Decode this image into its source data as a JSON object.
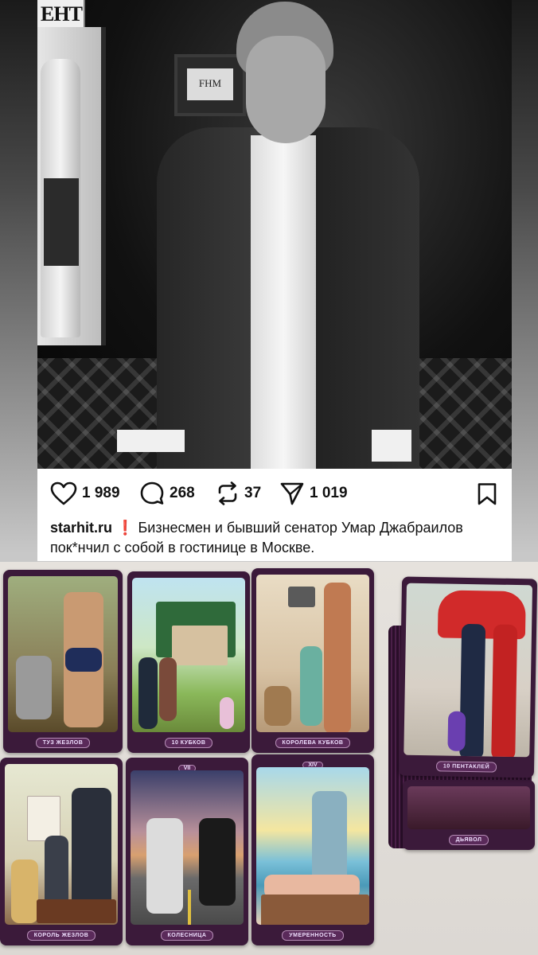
{
  "post": {
    "likes": "1 989",
    "comments": "268",
    "reposts": "37",
    "shares": "1 019",
    "caption_user": "starhit.ru",
    "caption_alert": "❗",
    "caption_text": "Бизнесмен и бывший сенатор Умар Джабраилов пок*нчил с собой в гостинице в Москве.",
    "photo_sign": "ЕНТ",
    "photo_plaque": "FHM"
  },
  "cards": {
    "c1": "ТУЗ ЖЕЗЛОВ",
    "c2": "10 КУБКОВ",
    "c3": "КОРОЛЕВА КУБКОВ",
    "c4": "10 ПЕНТАКЛЕЙ",
    "c5": "КОРОЛЬ ЖЕЗЛОВ",
    "c6": "КОЛЕСНИЦА",
    "c6_num": "VII",
    "c7": "УМЕРЕННОСТЬ",
    "c7_num": "XIV",
    "c8": "ДЬЯВОЛ"
  },
  "colors": {
    "alert": "#e0242a",
    "card_frame": "#3b1a3a",
    "card_label": "#5a2a5a"
  },
  "icons": [
    "heart-icon",
    "comment-icon",
    "repost-icon",
    "share-icon",
    "bookmark-icon"
  ]
}
